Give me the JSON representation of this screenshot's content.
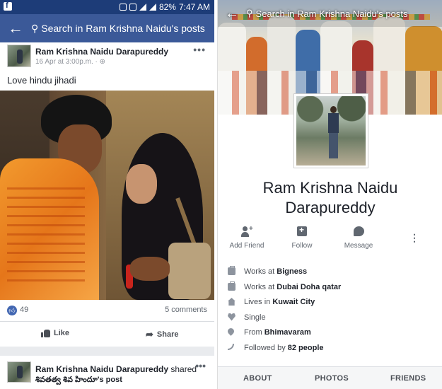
{
  "status_bar": {
    "battery": "82%",
    "time": "7:47 AM"
  },
  "left": {
    "search_text": "Search in Ram Krishna Naidu's posts",
    "post": {
      "author": "Ram Krishna Naidu Darapureddy",
      "meta": "16 Apr at 3:00p.m. · ",
      "text": "Love hindu jihadi",
      "likes": "49",
      "comments": "5 comments",
      "like_label": "Like",
      "share_label": "Share"
    },
    "post2": {
      "author": "Ram Krishna Naidu Darapureddy",
      "shared": " shared",
      "subtitle": "శివతత్వ శివ హిందూ's post"
    }
  },
  "right": {
    "search_text": "Search in Ram Krishna Naidu's posts",
    "name_line1": "Ram Krishna Naidu",
    "name_line2": "Darapureddy",
    "actions": {
      "add_friend": "Add Friend",
      "follow": "Follow",
      "message": "Message"
    },
    "about": [
      {
        "prefix": "Works at ",
        "bold": "Bigness",
        "icon": "briefcase-icon"
      },
      {
        "prefix": "Works at ",
        "bold": "Dubai Doha qatar",
        "icon": "briefcase-icon"
      },
      {
        "prefix": "Lives in ",
        "bold": "Kuwait City",
        "icon": "house-icon"
      },
      {
        "prefix": "Single",
        "bold": "",
        "icon": "heart-icon"
      },
      {
        "prefix": "From ",
        "bold": "Bhimavaram",
        "icon": "location-pin-icon"
      },
      {
        "prefix": "Followed by ",
        "bold": "82 people",
        "icon": "rss-icon"
      }
    ],
    "tabs": {
      "about": "ABOUT",
      "photos": "PHOTOS",
      "friends": "FRIENDS"
    }
  }
}
